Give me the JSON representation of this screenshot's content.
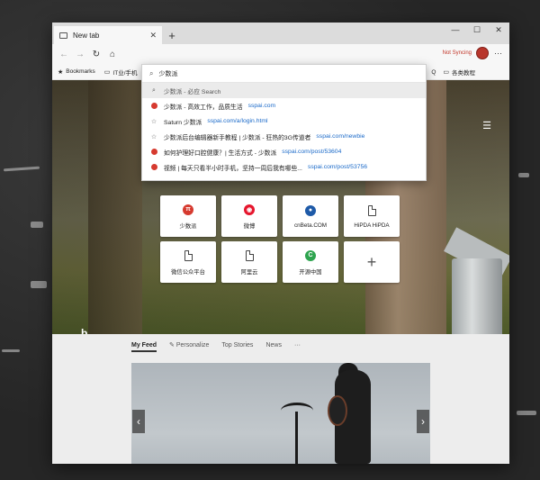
{
  "browser": {
    "tab_title": "New tab",
    "window_controls": {
      "minimize": "—",
      "maximize": "☐",
      "close": "✕"
    },
    "sync_label": "Not Syncing",
    "bookmarks": [
      {
        "label": "Bookmarks",
        "icon": "star-icon"
      },
      {
        "label": "IT业/手机",
        "icon": "folder-icon"
      }
    ],
    "bookmarks_right": [
      {
        "label": "Q",
        "icon": "folder-icon"
      },
      {
        "label": "各类教程",
        "icon": "folder-icon"
      }
    ]
  },
  "address": {
    "value": "少数派",
    "search_suggestion": "少数派 - 必应 Search",
    "suggestions": [
      {
        "icon": "site-icon",
        "title": "少数派 - 高效工作，品质生活",
        "url": "sspai.com"
      },
      {
        "icon": "star-icon",
        "title": "Saturn 少数派",
        "url": "sspai.com/a/login.html"
      },
      {
        "icon": "star-icon",
        "title": "少数派后台编辑器新手教程 | 少数派 - 狂热的3G传道者",
        "url": "sspai.com/newbie"
      },
      {
        "icon": "site-icon",
        "title": "如何护理好口腔健康？| 生活方式 - 少数派",
        "url": "sspai.com/post/53604"
      },
      {
        "icon": "site-icon",
        "title": "视频 | 每天只看半小时手机，坚持一周后我有哪些...",
        "url": "sspai.com/post/53756"
      }
    ]
  },
  "tiles": [
    {
      "label": "少数派",
      "icon": "π",
      "color": "#d63a2f"
    },
    {
      "label": "微博",
      "icon": "◉",
      "color": "#e6162d"
    },
    {
      "label": "cnBeta.COM",
      "icon": "●",
      "color": "#1e5aa8"
    },
    {
      "label": "HiPDA HiPDA",
      "icon": "doc"
    },
    {
      "label": "微信公众平台",
      "icon": "doc"
    },
    {
      "label": "阿里云",
      "icon": "doc"
    },
    {
      "label": "开源中国",
      "icon": "C",
      "color": "#2ea44f"
    },
    {
      "label": "+",
      "icon": "plus"
    }
  ],
  "feed": {
    "tabs": [
      "My Feed",
      "Personalize",
      "Top Stories",
      "News",
      "···"
    ]
  },
  "bing_logo": "b"
}
